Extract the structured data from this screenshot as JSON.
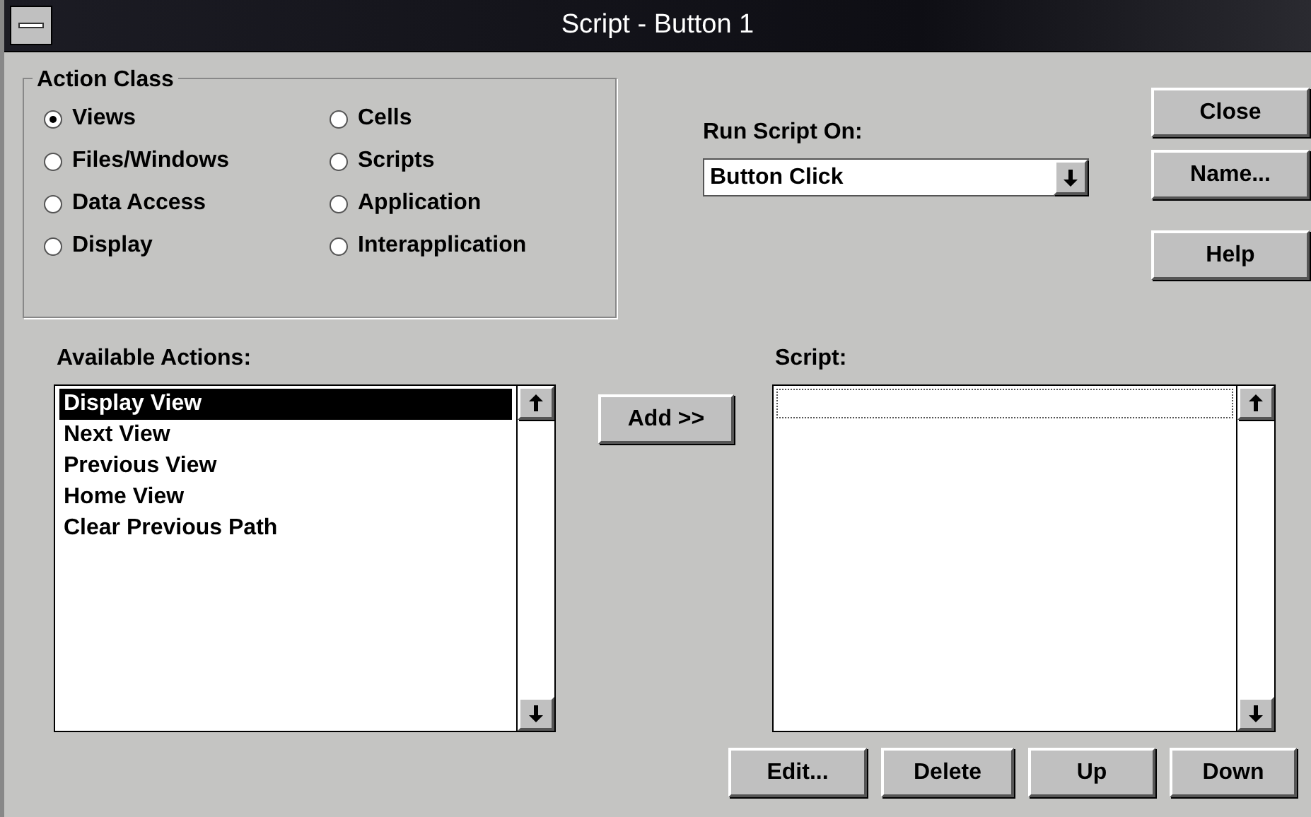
{
  "window": {
    "title": "Script - Button 1"
  },
  "action_class": {
    "title": "Action Class",
    "options": [
      {
        "label": "Views",
        "selected": true
      },
      {
        "label": "Files/Windows",
        "selected": false
      },
      {
        "label": "Data Access",
        "selected": false
      },
      {
        "label": "Display",
        "selected": false
      },
      {
        "label": "Cells",
        "selected": false
      },
      {
        "label": "Scripts",
        "selected": false
      },
      {
        "label": "Application",
        "selected": false
      },
      {
        "label": "Interapplication",
        "selected": false
      }
    ]
  },
  "run_script_on": {
    "label": "Run Script On:",
    "value": "Button Click"
  },
  "side_buttons": [
    {
      "label": "Close"
    },
    {
      "label": "Name..."
    },
    {
      "label": "Help"
    }
  ],
  "available_actions": {
    "label": "Available Actions:",
    "items": [
      {
        "label": "Display View",
        "selected": true
      },
      {
        "label": "Next View",
        "selected": false
      },
      {
        "label": "Previous View",
        "selected": false
      },
      {
        "label": "Home View",
        "selected": false
      },
      {
        "label": "Clear Previous Path",
        "selected": false
      }
    ]
  },
  "add_button": {
    "label": "Add >>"
  },
  "script": {
    "label": "Script:"
  },
  "bottom_buttons": [
    {
      "label": "Edit..."
    },
    {
      "label": "Delete"
    },
    {
      "label": "Up"
    },
    {
      "label": "Down"
    }
  ]
}
